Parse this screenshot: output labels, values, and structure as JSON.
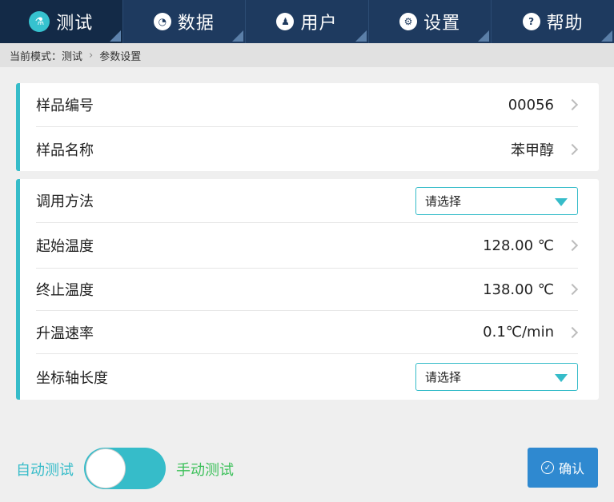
{
  "nav": {
    "tabs": [
      {
        "label": "测试",
        "icon": "flask-icon",
        "glyph": "⚗",
        "active": true
      },
      {
        "label": "数据",
        "icon": "pie-chart-icon",
        "glyph": "◔",
        "active": false
      },
      {
        "label": "用户",
        "icon": "user-icon",
        "glyph": "♟",
        "active": false
      },
      {
        "label": "设置",
        "icon": "gear-icon",
        "glyph": "⚙",
        "active": false
      },
      {
        "label": "帮助",
        "icon": "help-icon",
        "glyph": "?",
        "active": false
      }
    ]
  },
  "breadcrumb": {
    "mode": "当前模式：测试",
    "separator": "›",
    "current": "参数设置"
  },
  "sample": {
    "number_label": "样品编号",
    "number_value": "00056",
    "name_label": "样品名称",
    "name_value": "苯甲醇"
  },
  "params": {
    "method_label": "调用方法",
    "method_select": "请选择",
    "start_temp_label": "起始温度",
    "start_temp_value": "128.00 ℃",
    "end_temp_label": "终止温度",
    "end_temp_value": "138.00 ℃",
    "rate_label": "升温速率",
    "rate_value": "0.1℃/min",
    "axis_label": "坐标轴长度",
    "axis_select": "请选择"
  },
  "footer": {
    "auto_label": "自动测试",
    "manual_label": "手动测试",
    "confirm_label": "确认",
    "confirm_glyph": "✓"
  },
  "colors": {
    "nav_bg": "#1e3a5f",
    "accent": "#36bcc9",
    "manual_green": "#3cc05a",
    "confirm_blue": "#2f89d0"
  }
}
